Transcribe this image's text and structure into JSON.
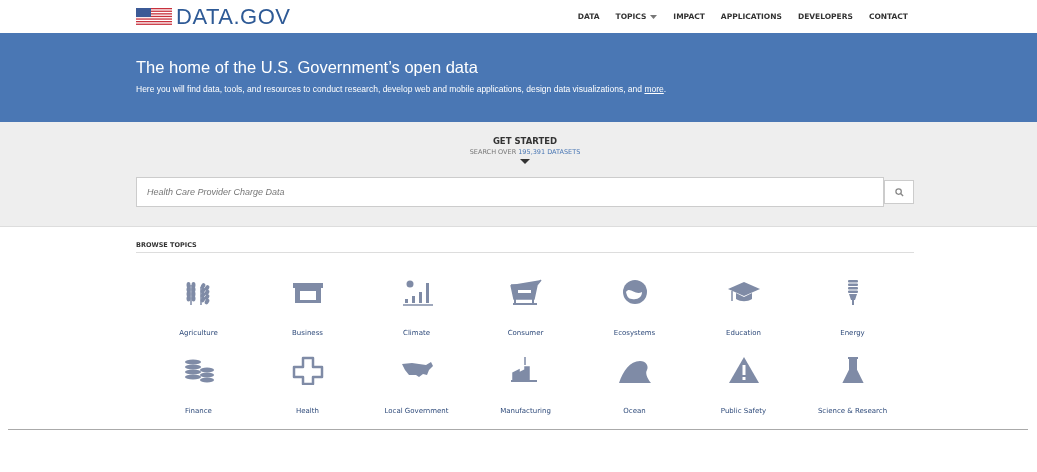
{
  "header": {
    "logo_text": "DATA.GOV",
    "nav": [
      {
        "label": "DATA",
        "dropdown": false
      },
      {
        "label": "TOPICS",
        "dropdown": true
      },
      {
        "label": "IMPACT",
        "dropdown": false
      },
      {
        "label": "APPLICATIONS",
        "dropdown": false
      },
      {
        "label": "DEVELOPERS",
        "dropdown": false
      },
      {
        "label": "CONTACT",
        "dropdown": false
      }
    ]
  },
  "hero": {
    "title": "The home of the U.S. Government’s open data",
    "text": "Here you will find data, tools, and resources to conduct research, develop web and mobile applications, design data visualizations, and",
    "link": "more",
    "end": "."
  },
  "get_started": {
    "title": "GET STARTED",
    "search_over": "SEARCH OVER",
    "count_link": "195,391 DATASETS",
    "search": {
      "placeholder": "Health Care Provider Charge Data"
    }
  },
  "browse_topics": {
    "title": "BROWSE TOPICS",
    "topics": [
      {
        "label": "Agriculture"
      },
      {
        "label": "Business"
      },
      {
        "label": "Climate"
      },
      {
        "label": "Consumer"
      },
      {
        "label": "Ecosystems"
      },
      {
        "label": "Education"
      },
      {
        "label": "Energy"
      },
      {
        "label": "Finance"
      },
      {
        "label": "Health"
      },
      {
        "label": "Local Government"
      },
      {
        "label": "Manufacturing"
      },
      {
        "label": "Ocean"
      },
      {
        "label": "Public Safety"
      },
      {
        "label": "Science & Research"
      }
    ]
  }
}
